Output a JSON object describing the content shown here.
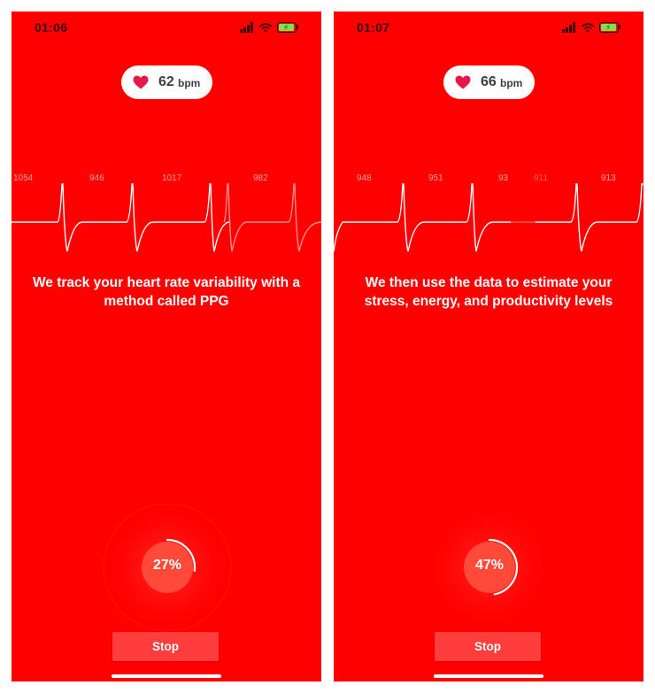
{
  "colors": {
    "background": "#ff0000",
    "pill": "#ffffff",
    "heart": "#e8174a",
    "stop_button": "#ff3d3d",
    "text": "#ffffff"
  },
  "screens": [
    {
      "status_time": "01:06",
      "bpm": {
        "value": "62",
        "unit": "bpm"
      },
      "rr_intervals": [
        "1054",
        "946",
        "1017",
        "982"
      ],
      "caption": "We track your heart rate variability with a method called PPG",
      "progress": {
        "percent": 27,
        "label": "27%"
      },
      "stop_label": "Stop"
    },
    {
      "status_time": "01:07",
      "bpm": {
        "value": "66",
        "unit": "bpm"
      },
      "rr_intervals": [
        "948",
        "951",
        "93",
        "911",
        "913"
      ],
      "caption": "We then use the data to estimate your stress, energy, and productivity levels",
      "progress": {
        "percent": 47,
        "label": "47%"
      },
      "stop_label": "Stop"
    }
  ],
  "icons": {
    "heart": "heart-icon",
    "signal": "cellular-signal-icon",
    "wifi": "wifi-icon",
    "battery": "battery-charging-icon"
  }
}
